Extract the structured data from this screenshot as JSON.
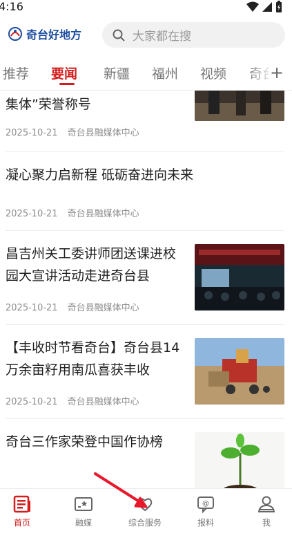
{
  "status": {
    "time": "4:16"
  },
  "header": {
    "logo_text": "奇台好地方",
    "search_placeholder": "大家都在搜"
  },
  "tabs": [
    {
      "label": "推荐"
    },
    {
      "label": "要闻"
    },
    {
      "label": "新疆"
    },
    {
      "label": "福州"
    },
    {
      "label": "视频"
    },
    {
      "label": "奇台"
    }
  ],
  "active_tab": "要闻",
  "news": [
    {
      "title": "集体”荣誉称号",
      "date": "2025-10-21",
      "source": "奇台县融媒体中心"
    },
    {
      "title": "凝心聚力启新程 砥砺奋进向未来",
      "date": "2025-10-21",
      "source": "奇台县融媒体中心"
    },
    {
      "title": "昌吉州关工委讲师团送课进校园大宣讲活动走进奇台县",
      "date": "2025-10-21",
      "source": "奇台县融媒体中心"
    },
    {
      "title": "【丰收时节看奇台】奇台县14万余亩籽用南瓜喜获丰收",
      "date": "2025-10-21",
      "source": "奇台县融媒体中心"
    },
    {
      "title": "奇台三作家荣登中国作协榜",
      "date": "",
      "source": ""
    }
  ],
  "bottom_nav": [
    {
      "label": "首页"
    },
    {
      "label": "融媒"
    },
    {
      "label": "综合服务"
    },
    {
      "label": "报料"
    },
    {
      "label": "我"
    }
  ],
  "colors": {
    "accent": "#d51b1b",
    "brand_blue": "#1c4ca0"
  }
}
